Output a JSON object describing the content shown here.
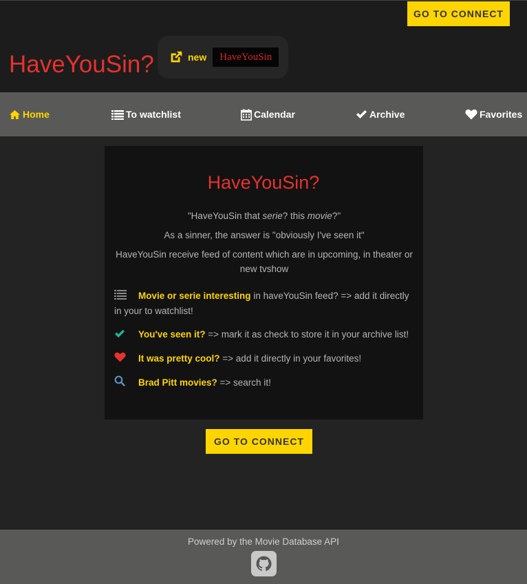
{
  "header": {
    "connect_label": "GO TO CONNECT",
    "brand": "HaveYouSin?",
    "new_label": "new",
    "logo_text": "HaveYouSin"
  },
  "nav": {
    "items": [
      {
        "label": "Home",
        "icon": "home-icon"
      },
      {
        "label": "To watchlist",
        "icon": "list-icon"
      },
      {
        "label": "Calendar",
        "icon": "calendar-icon"
      },
      {
        "label": "Archive",
        "icon": "check-icon"
      },
      {
        "label": "Favorites",
        "icon": "heart-icon"
      }
    ],
    "active": "Home"
  },
  "card": {
    "title": "HaveYouSin?",
    "quote_a": "\"HaveYouSin that ",
    "quote_b": "serie",
    "quote_c": "? this ",
    "quote_d": "movie",
    "quote_e": "?\"",
    "line2": "As a sinner, the answer is \"obviously I've seen it\"",
    "line3": "HaveYouSin receive feed of content which are in upcoming, in theater or new tvshow",
    "features": [
      {
        "icon": "list-icon",
        "highlight": "Movie or serie interesting",
        "text": " in haveYouSin feed? => add it directly in your to watchlist!"
      },
      {
        "icon": "check-icon",
        "highlight": "You've seen it?",
        "text": " => mark it as check to store it in your archive list!"
      },
      {
        "icon": "heart-icon",
        "highlight": "It was pretty cool?",
        "text": " => add it directly in your favorites!"
      },
      {
        "icon": "search-icon",
        "highlight": "Brad Pitt movies?",
        "text": " => search it!"
      }
    ]
  },
  "main": {
    "connect_label": "GO TO CONNECT"
  },
  "footer": {
    "text": "Powered by the Movie Database API",
    "icon": "github-icon"
  },
  "colors": {
    "accent": "#ffd500",
    "brand_red": "#e5322d",
    "background": "#232323",
    "nav_bg": "#595a58",
    "card_bg": "#121212",
    "check_teal": "#1bb99a",
    "heart_red": "#e5322d",
    "search_blue": "#5b8fb9"
  }
}
